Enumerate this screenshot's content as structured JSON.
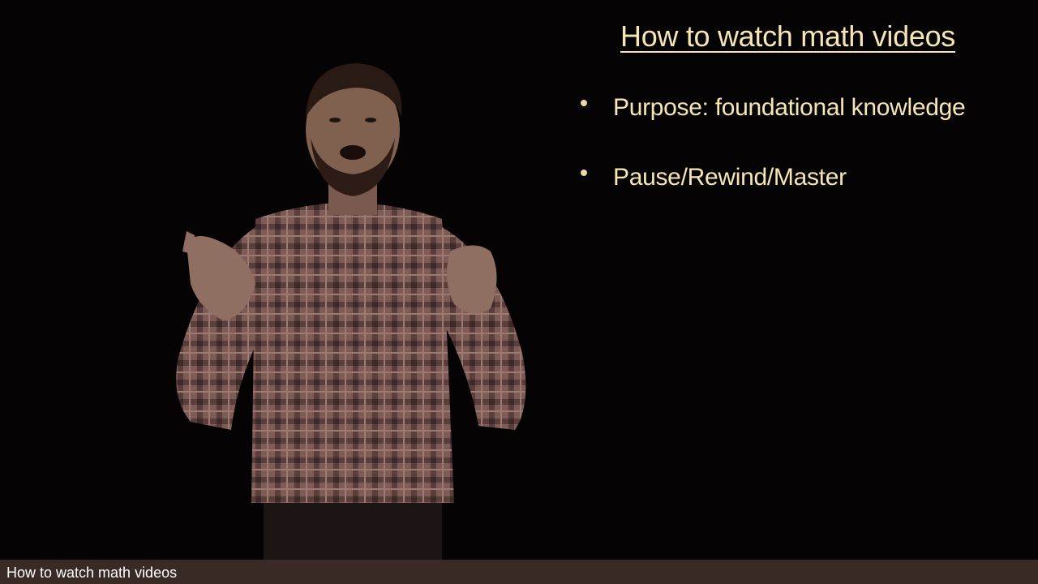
{
  "slide": {
    "title": "How to watch math videos",
    "bullets": [
      {
        "text": "Purpose: foundational knowledge"
      },
      {
        "text": "Pause/Rewind/Master"
      }
    ]
  },
  "caption": {
    "text": "How to watch math videos"
  },
  "colors": {
    "background": "#050303",
    "slide_text": "#f4e7b5",
    "caption_bar": "#3a2a26",
    "caption_text": "#ffffff",
    "shirt": "#8a6660"
  }
}
